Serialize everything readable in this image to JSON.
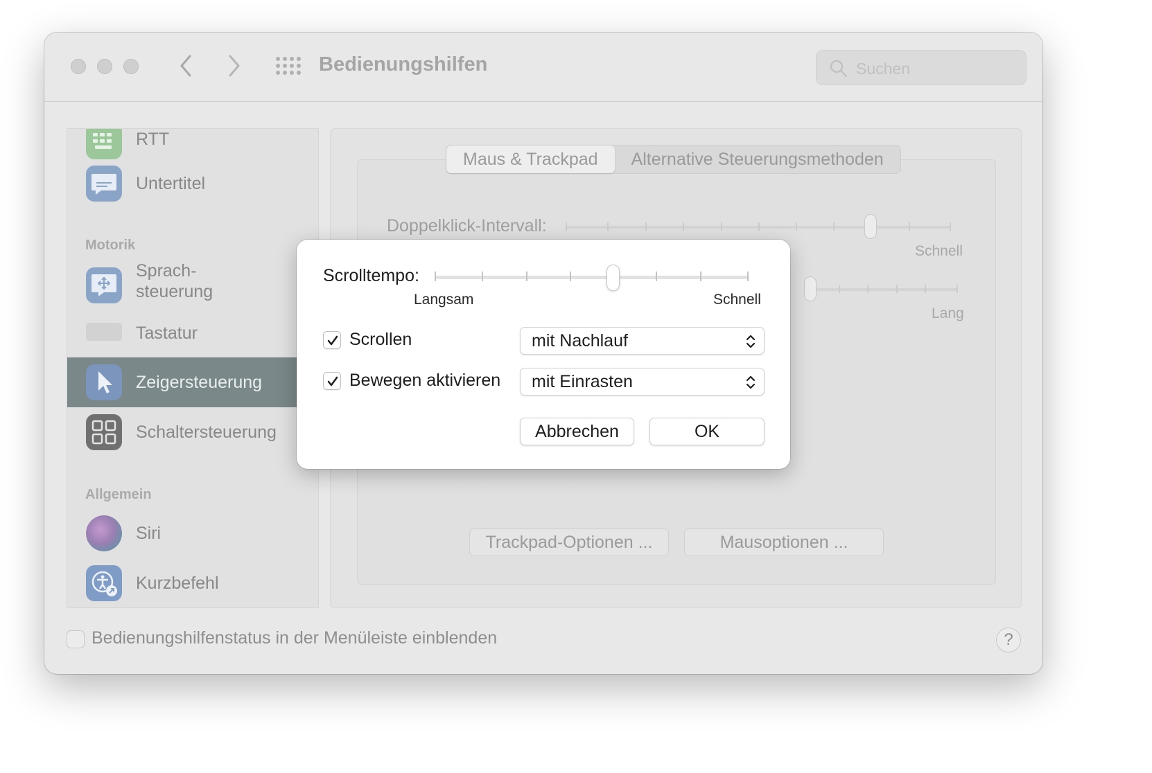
{
  "window": {
    "title": "Bedienungshilfen",
    "search_placeholder": "Suchen"
  },
  "sidebar": {
    "items_top": [
      {
        "label": "RTT",
        "icon": "keyboard-rtt-icon"
      },
      {
        "label": "Untertitel",
        "icon": "captions-icon"
      }
    ],
    "section_motorik": "Motorik",
    "items_motorik": [
      {
        "label": "Sprach-",
        "label2": "steuerung",
        "icon": "voice-control-icon"
      },
      {
        "label": "Tastatur",
        "icon": "keyboard-icon"
      },
      {
        "label": "Zeigersteuerung",
        "icon": "pointer-icon",
        "selected": true
      },
      {
        "label": "Schaltersteuerung",
        "icon": "switch-control-icon"
      }
    ],
    "section_allgemein": "Allgemein",
    "items_allgemein": [
      {
        "label": "Siri",
        "icon": "siri-icon"
      },
      {
        "label": "Kurzbefehl",
        "icon": "accessibility-shortcut-icon"
      }
    ]
  },
  "content": {
    "tabs": [
      "Maus & Trackpad",
      "Alternative Steuerungsmethoden"
    ],
    "double_click_label": "Doppelklick-Intervall:",
    "double_click_right": "Schnell",
    "second_slider_right": "Lang",
    "trackpad_button": "Trackpad-Optionen ...",
    "mouse_button": "Mausoptionen ..."
  },
  "footer": {
    "checkbox_label": "Bedienungshilfenstatus in der Menüleiste einblenden",
    "help": "?"
  },
  "dialog": {
    "scroll_speed_label": "Scrolltempo:",
    "slider_min": "Langsam",
    "slider_max": "Schnell",
    "scroll_speed_value": 0.57,
    "scroll_checkbox_label": "Scrollen",
    "scroll_checked": true,
    "scroll_popup_value": "mit Nachlauf",
    "move_checkbox_label": "Bewegen aktivieren",
    "move_checked": true,
    "move_popup_value": "mit Einrasten",
    "cancel_button": "Abbrechen",
    "ok_button": "OK"
  },
  "colors": {
    "selected_sidebar": "#7a8889",
    "dialog_bg": "#ffffff"
  }
}
